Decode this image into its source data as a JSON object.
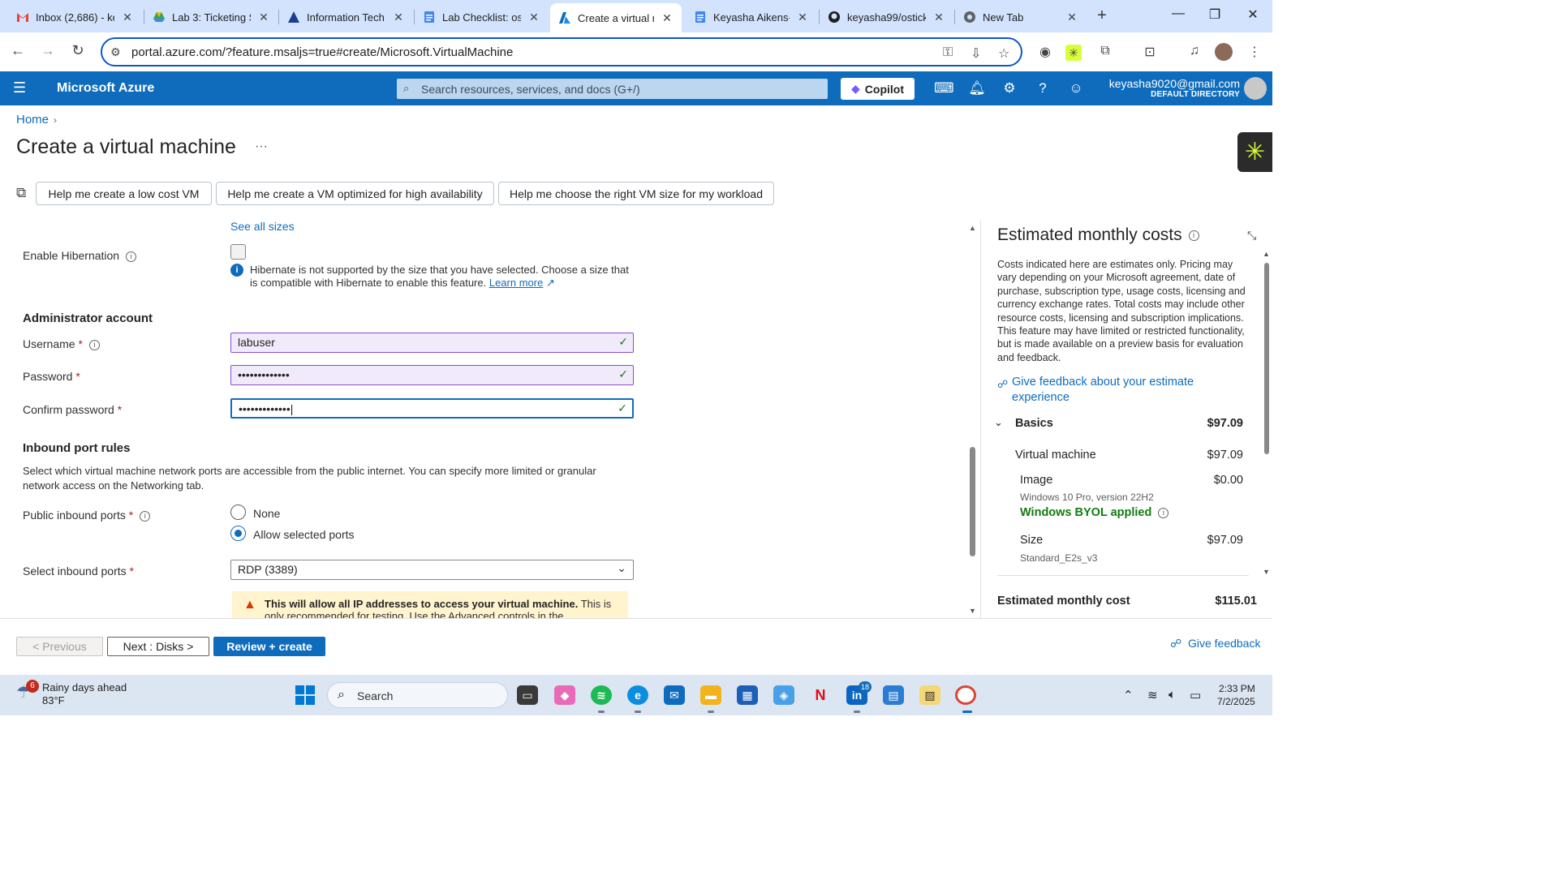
{
  "browser": {
    "tabs": [
      {
        "title": "Inbox (2,686) - ke",
        "icon": "gmail-icon"
      },
      {
        "title": "Lab 3: Ticketing S",
        "icon": "google-drive-icon"
      },
      {
        "title": "Information Tech",
        "icon": "app-icon"
      },
      {
        "title": "Lab Checklist: osT",
        "icon": "google-docs-icon"
      },
      {
        "title": "Create a virtual m",
        "icon": "azure-icon"
      },
      {
        "title": "Keyasha Aikens-B",
        "icon": "google-docs-icon"
      },
      {
        "title": "keyasha99/ostick",
        "icon": "github-icon"
      },
      {
        "title": "New Tab",
        "icon": "chrome-icon"
      }
    ],
    "url": "portal.azure.com/?feature.msaljs=true#create/Microsoft.VirtualMachine"
  },
  "azure": {
    "brand": "Microsoft Azure",
    "search_placeholder": "Search resources, services, and docs (G+/)",
    "copilot_label": "Copilot",
    "email": "keyasha9020@gmail.com",
    "directory": "DEFAULT DIRECTORY"
  },
  "page": {
    "breadcrumb_home": "Home",
    "title": "Create a virtual machine",
    "ai_buttons": [
      "Help me create a low cost VM",
      "Help me create a VM optimized for high availability",
      "Help me choose the right VM size for my workload"
    ]
  },
  "form": {
    "see_all_sizes": "See all sizes",
    "hibernation_label": "Enable Hibernation",
    "hibernation_info": "Hibernate is not supported by the size that you have selected. Choose a size that is compatible with Hibernate to enable this feature.",
    "learn_more": "Learn more",
    "admin_section": "Administrator account",
    "username_label": "Username",
    "username_value": "labuser",
    "password_label": "Password",
    "password_value": "•••••••••••••",
    "confirm_label": "Confirm password",
    "confirm_value": "•••••••••••••",
    "inbound_section": "Inbound port rules",
    "inbound_desc": "Select which virtual machine network ports are accessible from the public internet. You can specify more limited or granular network access on the Networking tab.",
    "public_ports_label": "Public inbound ports",
    "radio_none": "None",
    "radio_allow": "Allow selected ports",
    "select_ports_label": "Select inbound ports",
    "select_ports_value": "RDP (3389)",
    "warning_bold": "This will allow all IP addresses to access your virtual machine.",
    "warning_rest": "This is only recommended for testing.  Use the Advanced controls in the Networking tab to"
  },
  "costs": {
    "title": "Estimated monthly costs",
    "description": "Costs indicated here are estimates only. Pricing may vary depending on your Microsoft agreement, date of purchase, subscription type, usage costs, licensing and currency exchange rates. Total costs may include other resource costs, licensing and subscription implications. This feature may have limited or restricted functionality, but is made available on a preview basis for evaluation and feedback.",
    "feedback_link": "Give feedback about your estimate experience",
    "basics_label": "Basics",
    "basics_amount": "$97.09",
    "vm_label": "Virtual machine",
    "vm_amount": "$97.09",
    "image_label": "Image",
    "image_amount": "$0.00",
    "image_sub": "Windows 10 Pro, version 22H2",
    "byol": "Windows BYOL applied",
    "size_label": "Size",
    "size_amount": "$97.09",
    "size_sub": "Standard_E2s_v3",
    "total_label": "Estimated monthly cost",
    "total_amount": "$115.01"
  },
  "actions": {
    "previous": "< Previous",
    "next": "Next : Disks >",
    "review": "Review + create",
    "give_feedback": "Give feedback"
  },
  "taskbar": {
    "weather_title": "Rainy days ahead",
    "weather_temp": "83°F",
    "weather_badge": "6",
    "search": "Search",
    "linkedin_badge": "18",
    "time": "2:33 PM",
    "date": "7/2/2025"
  }
}
